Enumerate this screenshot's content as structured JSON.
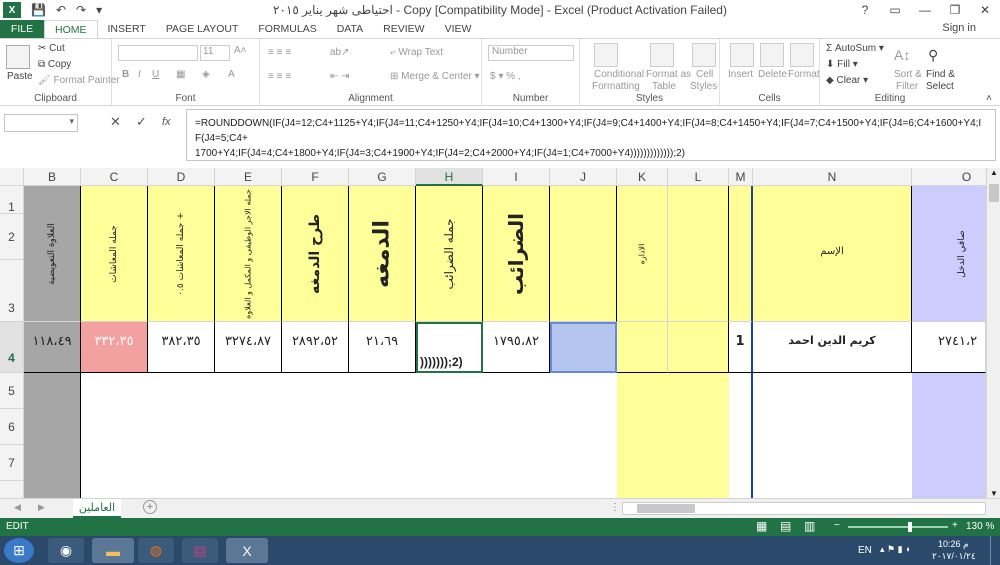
{
  "window": {
    "title": "احتياطى شهر يناير ٢٠١٥ - Copy  [Compatibility Mode] - Excel (Product Activation Failed)",
    "help": "?",
    "minimize": "—",
    "restore": "❐",
    "close": "✕"
  },
  "tabs": [
    "FILE",
    "HOME",
    "INSERT",
    "PAGE LAYOUT",
    "FORMULAS",
    "DATA",
    "REVIEW",
    "VIEW"
  ],
  "signin": "Sign in",
  "ribbon": {
    "paste": "Paste",
    "cut": "Cut",
    "copy": "Copy",
    "format_painter": "Format Painter",
    "clipboard": "Clipboard",
    "font_size": "11",
    "font": "Font",
    "wrap_text": "Wrap Text",
    "merge_center": "Merge & Center",
    "alignment": "Alignment",
    "number_format": "Number",
    "number": "Number",
    "conditional_formatting_1": "Conditional",
    "conditional_formatting_2": "Formatting",
    "format_as_table_1": "Format as",
    "format_as_table_2": "Table",
    "cell_styles_1": "Cell",
    "cell_styles_2": "Styles",
    "styles": "Styles",
    "insert": "Insert",
    "delete": "Delete",
    "format": "Format",
    "cells": "Cells",
    "autosum": "AutoSum",
    "fill": "Fill",
    "clear": "Clear",
    "sort_filter_1": "Sort &",
    "sort_filter_2": "Filter",
    "find_select_1": "Find &",
    "find_select_2": "Select",
    "editing": "Editing"
  },
  "formula_bar": {
    "name_box": "",
    "cancel": "✕",
    "enter": "✓",
    "fx": "fx",
    "formula_line1": "=ROUNDDOWN(IF(J4=12;C4+1125+Y4;IF(J4=11;C4+1250+Y4;IF(J4=10;C4+1300+Y4;IF(J4=9;C4+1400+Y4;IF(J4=8;C4+1450+Y4;IF(J4=7;C4+1500+Y4;IF(J4=6;C4+1600+Y4;IF(J4=5;C4+",
    "formula_line2": "1700+Y4;IF(J4=4;C4+1800+Y4;IF(J4=3;C4+1900+Y4;IF(J4=2;C4+2000+Y4;IF(J4=1;C4+7000+Y4)))))))))))));2)"
  },
  "columns": [
    "B",
    "C",
    "D",
    "E",
    "F",
    "G",
    "H",
    "I",
    "J",
    "K",
    "L",
    "M",
    "N",
    "O"
  ],
  "rows": [
    "1",
    "2",
    "3",
    "4",
    "5",
    "6",
    "7"
  ],
  "headers": {
    "B": "العلاوة التعويضية",
    "C": "جمله المعاشات",
    "D": "جمله المعاشات ٠.٥ +",
    "E": "جمله الاجر الوظيفى و المكمل و العلاوه",
    "F": "طرح الدمغه",
    "G": "الدمغه",
    "H": "جمله الضرائب",
    "I": "الضرائب",
    "K": "الاداره",
    "N": "الإسم",
    "O": "صافي الدخل"
  },
  "row4": {
    "B": "١١٨،٤٩",
    "C": "٣٣٢،٣٥",
    "D": "٣٨٢،٣٥",
    "E": "٣٢٧٤،٨٧",
    "F": "٢٨٩٢،٥٢",
    "G": "٢١،٦٩",
    "H": ")))))));2)",
    "I": "١٧٩٥،٨٢",
    "M": "1",
    "N": "كريم الدين احمد",
    "O": "٢٧٤١،٢"
  },
  "sheet_tab": "العاملين",
  "add_sheet": "+",
  "status": {
    "mode": "EDIT",
    "zoom": "130 %"
  },
  "taskbar": {
    "lang": "EN",
    "time": "10:26 م",
    "date": "٢٠١٧/٠١/٢٤"
  },
  "colors": {
    "excel_green": "#217346",
    "header_yellow": "#ffff99",
    "header_lavender": "#ccccff",
    "gray_col": "#a6a6a6",
    "pink_cell": "#f2a0a0",
    "selected_blue": "#b4c6f0"
  }
}
